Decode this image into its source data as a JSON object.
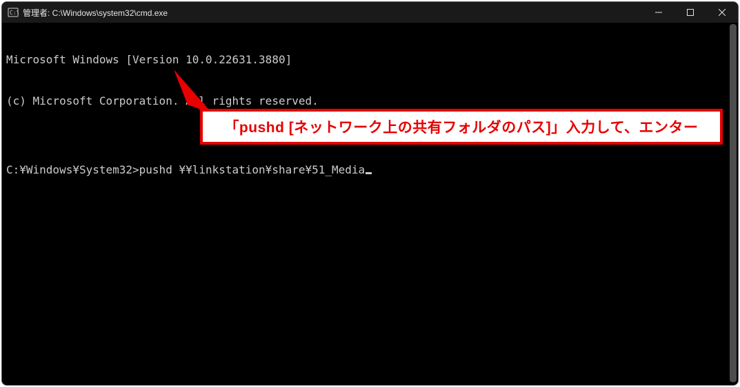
{
  "window": {
    "title": "管理者: C:\\Windows\\system32\\cmd.exe"
  },
  "terminal": {
    "line1": "Microsoft Windows [Version 10.0.22631.3880]",
    "line2": "(c) Microsoft Corporation. All rights reserved.",
    "blank": "",
    "prompt": "C:¥Windows¥System32>",
    "command": "pushd ¥¥linkstation¥share¥51_Media"
  },
  "callout": {
    "text": "「pushd [ネットワーク上の共有フォルダのパス]」入力して、エンター"
  }
}
